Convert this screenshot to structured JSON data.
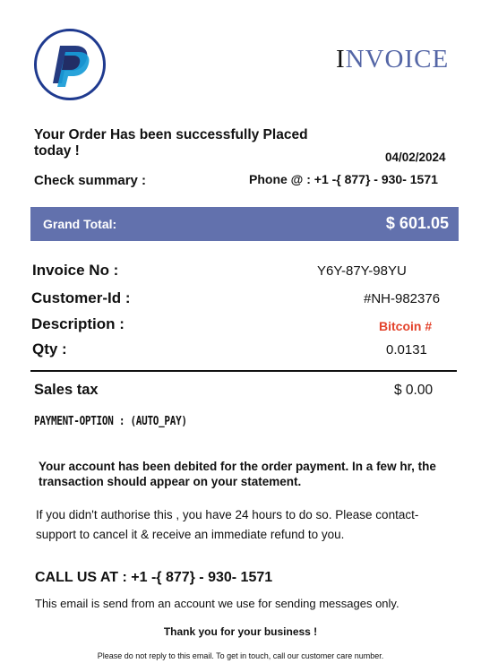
{
  "header": {
    "logo_icon": "paypal-logo-icon",
    "title_first": "I",
    "title_rest": "NVOICE"
  },
  "order": {
    "message": "Your Order Has been successfully Placed today  !",
    "date": "04/02/2024",
    "check_summary": "Check summary :",
    "phone": "Phone @  : +1 -{ 877} - 930- 1571"
  },
  "total": {
    "label": "Grand Total:",
    "value": "$ 601.05"
  },
  "details": {
    "invoice_no_label": "Invoice No :",
    "invoice_no_value": "Y6Y-87Y-98YU",
    "customer_id_label": "Customer-Id :",
    "customer_id_value": "#NH-982376",
    "description_label": "Description :",
    "description_value": "Bitcoin #",
    "qty_label": "Qty :",
    "qty_value": "0.0131",
    "sales_tax_label": "Sales tax",
    "sales_tax_value": "$ 0.00",
    "payment_option": "PAYMENT-OPTION : (AUTO_PAY)"
  },
  "notice": {
    "debit_message": "Your account has been debited for the order payment. In a few hr, the transaction should appear on your statement.",
    "authorise_message": "If you didn't authorise this , you have 24 hours to do so. Please contact- support to cancel it & receive an immediate refund to you.",
    "call_us": "CALL US AT  : +1 -{ 877} - 930- 1571",
    "email_note": "This email is send from an account we use for sending messages only.",
    "thank_you": "Thank you for your business !",
    "footer": "Please do not reply to this email. To get in touch, call our customer care number."
  },
  "colors": {
    "accent": "#6271ad",
    "title": "#5466a6",
    "highlight": "#e3432c",
    "logo_ring": "#1f3a8f",
    "logo_dark": "#253b80",
    "logo_light": "#179bd7"
  }
}
